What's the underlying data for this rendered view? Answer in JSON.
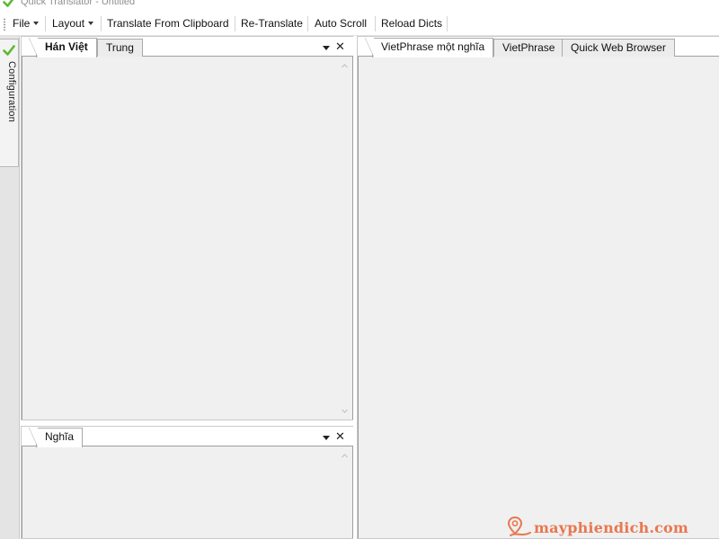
{
  "window": {
    "title": "Quick Translator - Untitled"
  },
  "menubar": {
    "items": [
      {
        "label": "File",
        "dropdown": true
      },
      {
        "label": "Layout",
        "dropdown": true
      },
      {
        "label": "Translate From Clipboard",
        "dropdown": false
      },
      {
        "label": "Re-Translate",
        "dropdown": false
      },
      {
        "label": "Auto Scroll",
        "dropdown": false
      },
      {
        "label": "Reload Dicts",
        "dropdown": false
      }
    ]
  },
  "side_strip": {
    "tab_label": "Configuration",
    "icon": "check-icon"
  },
  "left_top_panel": {
    "tabs": [
      {
        "label": "Hán Việt",
        "active": true
      },
      {
        "label": "Trung",
        "active": false
      }
    ]
  },
  "left_bottom_panel": {
    "tabs": [
      {
        "label": "Nghĩa",
        "active": true
      }
    ]
  },
  "right_panel": {
    "tabs": [
      {
        "label": "VietPhrase một nghĩa",
        "active": true
      },
      {
        "label": "VietPhrase",
        "active": false
      },
      {
        "label": "Quick Web Browser",
        "active": false
      }
    ]
  },
  "panel_controls": {
    "dropdown_icon": "chevron-down-icon",
    "close_glyph": "✕"
  },
  "watermark": {
    "text": "mayphiendich.com",
    "color": "#e8774f"
  },
  "colors": {
    "accent_check": "#5cb82e",
    "panel_bg": "#f0f0f0"
  }
}
